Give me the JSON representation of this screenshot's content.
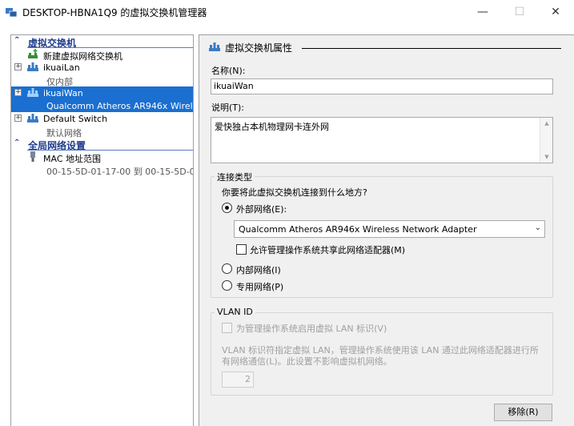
{
  "window": {
    "title": "DESKTOP-HBNA1Q9 的虚拟交换机管理器",
    "min_glyph": "—",
    "max_glyph": "☐",
    "close_glyph": "✕"
  },
  "sidebar": {
    "virtual_switches_header": "虚拟交换机",
    "new_switch": "新建虚拟网络交换机",
    "switches": [
      {
        "name": "ikuaiLan",
        "detail": "仅内部",
        "expand": "+"
      },
      {
        "name": "ikuaiWan",
        "detail": "Qualcomm Atheros AR946x Wirele...",
        "expand": "+"
      },
      {
        "name": "Default Switch",
        "detail": "默认网络",
        "expand": "+"
      }
    ],
    "global_header": "全局网络设置",
    "mac_range": {
      "name": "MAC 地址范围",
      "detail": "00-15-5D-01-17-00 到 00-15-5D-0..."
    }
  },
  "props": {
    "header": "虚拟交换机属性",
    "name_label": "名称(N):",
    "name_value": "ikuaiWan",
    "desc_label": "说明(T):",
    "desc_value": "爱快独占本机物理网卡连外网",
    "conn_group_title": "连接类型",
    "conn_question": "你要将此虚拟交换机连接到什么地方?",
    "external_label": "外部网络(E):",
    "adapter_selected": "Qualcomm Atheros AR946x Wireless Network Adapter",
    "allow_mgmt_label": "允许管理操作系统共享此网络适配器(M)",
    "internal_label": "内部网络(I)",
    "private_label": "专用网络(P)",
    "vlan_group_title": "VLAN ID",
    "vlan_enable_label": "为管理操作系统启用虚拟 LAN 标识(V)",
    "vlan_desc": "VLAN 标识符指定虚拟 LAN，管理操作系统使用该 LAN 通过此网络适配器进行所有网络通信(L)。此设置不影响虚拟机网络。",
    "vlan_value": "2",
    "remove_button": "移除(R)"
  }
}
